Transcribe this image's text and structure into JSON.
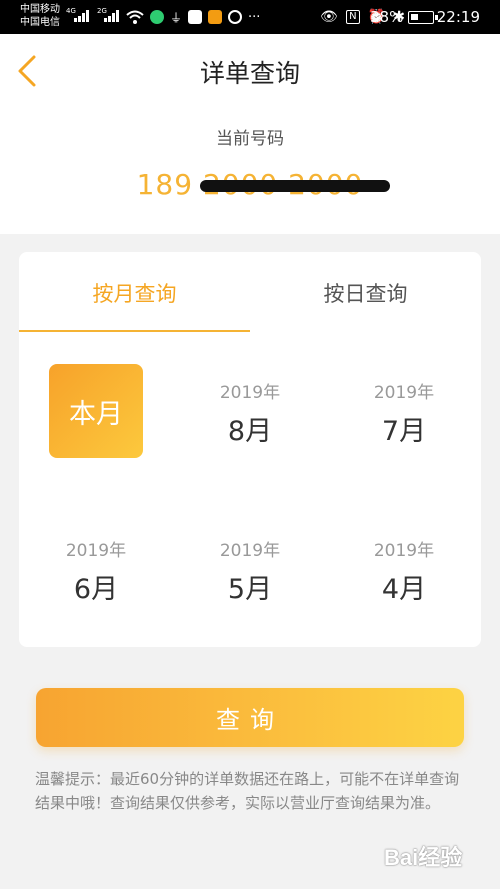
{
  "status_bar": {
    "carrier_1": "中国移动",
    "carrier_2": "中国电信",
    "net_1": "4G",
    "net_2": "2G",
    "battery": "38%",
    "battery_level": 0.38,
    "time": "22:19"
  },
  "header": {
    "title": "详单查询",
    "number_label": "当前号码",
    "number_value": "189 2000 2000"
  },
  "tabs": [
    {
      "label": "按月查询",
      "active": true
    },
    {
      "label": "按日查询",
      "active": false
    }
  ],
  "months": {
    "current": "本月",
    "items": [
      {
        "year": "2019年",
        "month": "8月"
      },
      {
        "year": "2019年",
        "month": "7月"
      },
      {
        "year": "2019年",
        "month": "6月"
      },
      {
        "year": "2019年",
        "month": "5月"
      },
      {
        "year": "2019年",
        "month": "4月"
      }
    ]
  },
  "query_button": "查询",
  "tip": "温馨提示：最近60分钟的详单数据还在路上，可能不在详单查询结果中哦！查询结果仅供参考，实际以营业厅查询结果为准。",
  "watermark": "Bai经验",
  "colors": {
    "accent": "#f5a623",
    "accent_light": "#fdd343",
    "number": "#f5b334"
  }
}
